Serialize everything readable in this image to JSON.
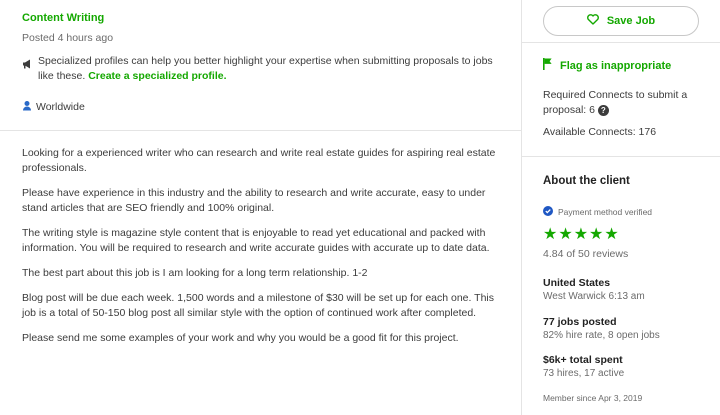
{
  "job": {
    "category": "Content Writing",
    "posted": "Posted 4 hours ago",
    "promo_text": "Specialized profiles can help you better highlight your expertise when submitting proposals to jobs like these. ",
    "promo_link": "Create a specialized profile.",
    "location": "Worldwide",
    "description": [
      "Looking for a experienced writer who can research and write real estate guides for aspiring real estate professionals.",
      "Please have experience in this industry and the ability to research and write accurate, easy to under stand articles that are SEO friendly and 100% original.",
      "The writing style is magazine style content that is enjoyable to read yet educational and packed with information. You will be required to research and write accurate guides with accurate up to date data.",
      "The best part about this job is I am looking for a long term relationship. 1-2",
      "Blog post will be due each week. 1,500 words and a milestone of $30 will be set up for each one. This job is a total of 50-150 blog post all similar style with the option of continued work after completed.",
      "Please send me some examples of your work and why you would be a good fit for this project."
    ]
  },
  "sidebar": {
    "save_label": "Save Job",
    "flag_label": "Flag as inappropriate",
    "required_connects": "Required Connects to submit a proposal: 6",
    "available_connects": "Available Connects: 176"
  },
  "client": {
    "heading": "About the client",
    "payment": "Payment method verified",
    "rating": "4.84 of 50 reviews",
    "stars": 5,
    "country": "United States",
    "city_time": "West Warwick 6:13 am",
    "jobs_posted": "77 jobs posted",
    "hire_rate": "82% hire rate, 8 open jobs",
    "total_spent": "$6k+ total spent",
    "hires": "73 hires, 17 active",
    "member_since": "Member since Apr 3, 2019"
  },
  "colors": {
    "accent": "#14a800",
    "text": "#3c3c3c",
    "muted": "#6b6b6b",
    "divider": "#e4e4e4",
    "verified": "#1f57c3"
  },
  "icons": [
    "megaphone-icon",
    "location-pin-icon",
    "heart-icon",
    "flag-icon",
    "help-icon",
    "verified-badge-icon",
    "star-icon"
  ]
}
